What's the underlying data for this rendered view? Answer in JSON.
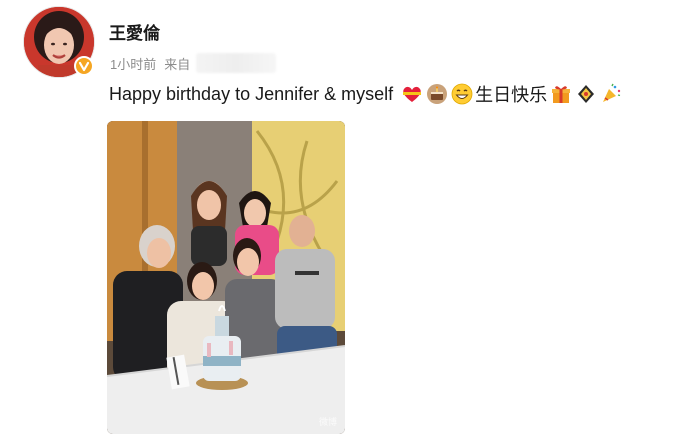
{
  "post": {
    "username": "王愛倫",
    "time": "1小时前",
    "from_label": "来自",
    "text": "Happy birthday to Jennifer & myself",
    "text_cjk": "生日快乐"
  },
  "emojis": [
    "heart-gift-icon",
    "birthday-cake-icon",
    "grinning-face-icon",
    "gift-box-icon",
    "lantern-icon",
    "party-popper-icon"
  ],
  "photo": {
    "watermark": "微博"
  },
  "colors": {
    "verified_badge": "#f5a623",
    "text": "#1a1a1a",
    "meta": "#8c8c8c"
  }
}
